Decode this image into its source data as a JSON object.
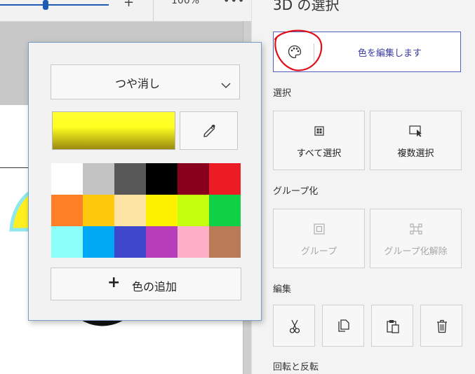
{
  "toolbar": {
    "zoom": "100%",
    "plus": "+",
    "more": "•••"
  },
  "panel": {
    "title": "3D の選択",
    "edit_color_label": "色を編集します",
    "section_select": "選択",
    "select_all": "すべて選択",
    "multi_select": "複数選択",
    "section_group": "グループ化",
    "group": "グループ",
    "ungroup": "グループ化解除",
    "section_edit": "編集",
    "section_rotate": "回転と反転"
  },
  "popup": {
    "finish_value": "つや消し",
    "add_color_label": "色の追加",
    "add_color_icon": "+",
    "current_color_gradient": [
      "#ffff33",
      "#ffff20",
      "#9a8a10"
    ],
    "palette": [
      "#ffffff",
      "#c3c3c3",
      "#585858",
      "#000000",
      "#88001b",
      "#ec1c24",
      "#ff7f27",
      "#ffc90e",
      "#fde4a4",
      "#fff200",
      "#c4ff0e",
      "#0ed145",
      "#8cfffb",
      "#00a8f3",
      "#3f48cc",
      "#b83dba",
      "#ffaec8",
      "#b97a56"
    ]
  },
  "icons": {
    "palette": "palette-icon",
    "eyedropper": "eyedropper-icon",
    "chevron": "chevron-down-icon",
    "select_all": "select-all-icon",
    "multi_select": "multi-select-icon",
    "group": "group-icon",
    "ungroup": "ungroup-icon",
    "cut": "cut-icon",
    "copy": "copy-icon",
    "paste": "paste-icon",
    "delete": "trash-icon"
  },
  "colors": {
    "accent": "#3a3aa0",
    "annotation": "#e0101a",
    "focus_border": "#5060c0"
  }
}
